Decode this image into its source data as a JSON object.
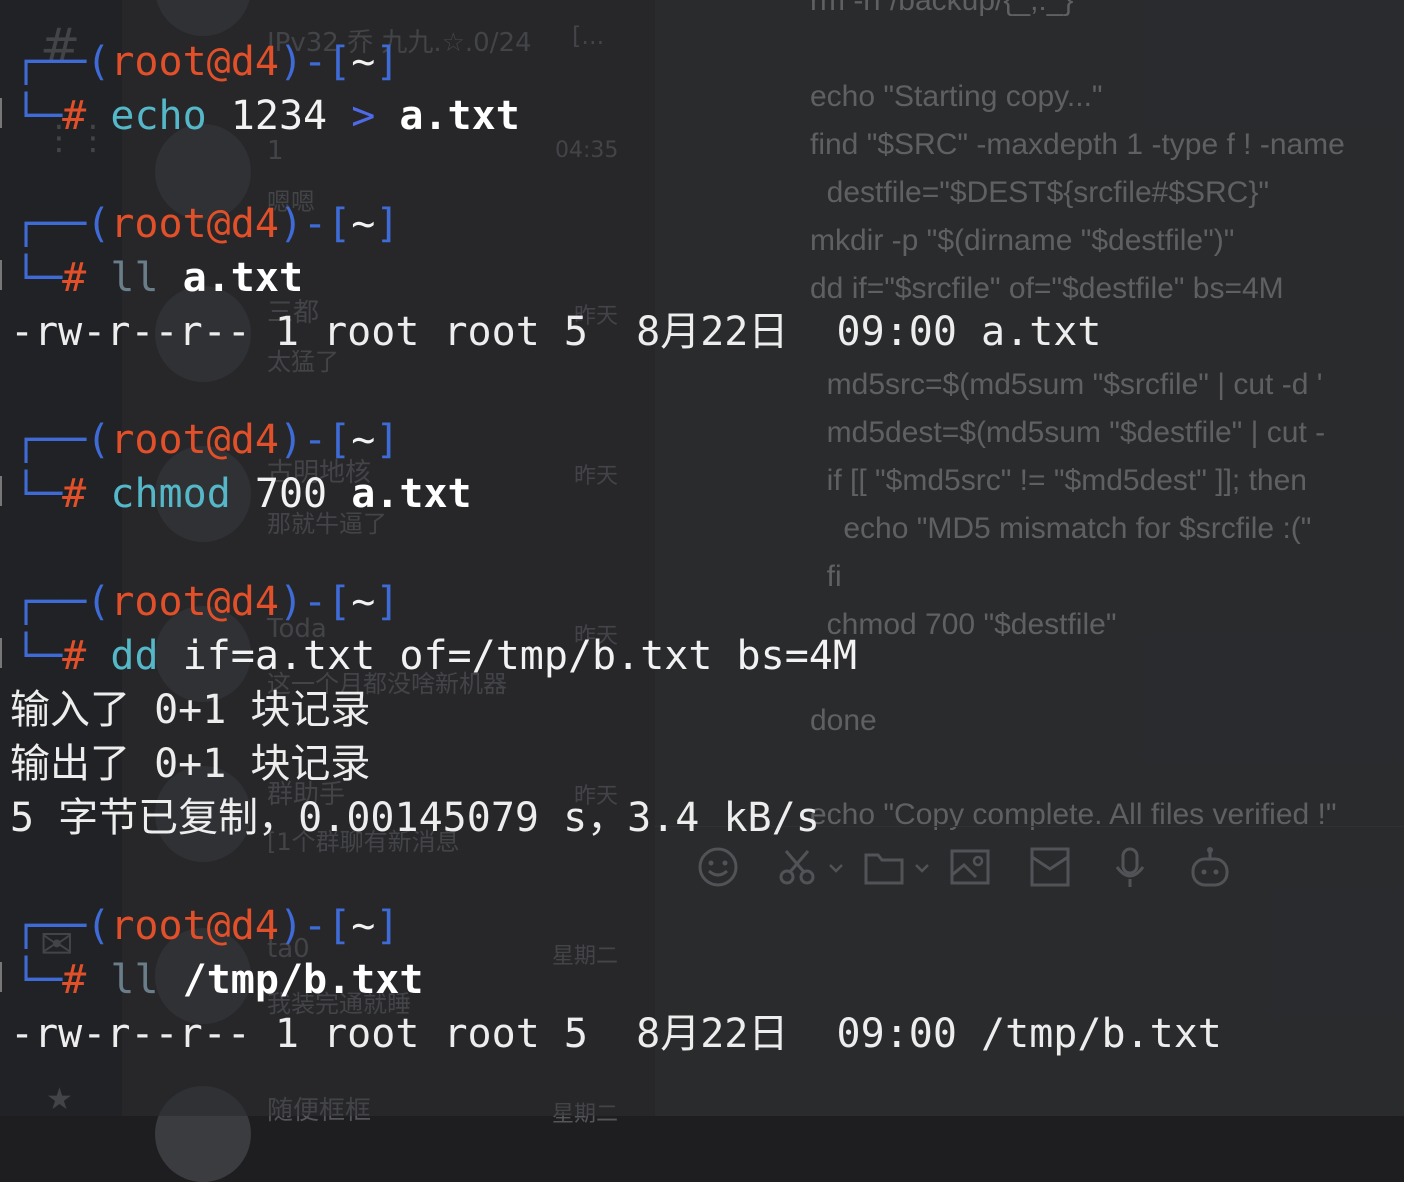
{
  "background_app": {
    "list_items": [
      {
        "name": "IPv32 乔 九九.☆.0/24",
        "preview": "[...",
        "time": ""
      },
      {
        "name": "1",
        "preview": "嗯嗯",
        "time": "04:35"
      },
      {
        "name": "三都",
        "preview": "太猛了",
        "time": "昨天"
      },
      {
        "name": "古明地核",
        "preview": "那就牛逼了",
        "time": "昨天"
      },
      {
        "name": "Toda",
        "preview": "这一个月都没啥新机器",
        "time": "昨天"
      },
      {
        "name": "群助手",
        "preview": "[1个群聊有新消息",
        "time": "昨天"
      },
      {
        "name": "ta0",
        "preview": "我装完通就睡",
        "time": "星期二"
      },
      {
        "name": "随便框框",
        "preview": "",
        "time": "星期二"
      }
    ],
    "chat_code_lines": [
      "rm -rf /backup/{_,:_}",
      "",
      "echo \"Starting copy...\"",
      "find \"$SRC\" -maxdepth 1 -type f ! -name",
      "  destfile=\"$DEST${srcfile#$SRC}\"",
      "mkdir -p \"$(dirname \"$destfile\")\"",
      "dd if=\"$srcfile\" of=\"$destfile\" bs=4M",
      "",
      "  md5src=$(md5sum \"$srcfile\" | cut -d '",
      "  md5dest=$(md5sum \"$destfile\" | cut -",
      "  if [[ \"$md5src\" != \"$md5dest\" ]]; then",
      "    echo \"MD5 mismatch for $srcfile :(\"",
      "  fi",
      "  chmod 700 \"$destfile\"",
      "",
      "done",
      "",
      "echo \"Copy complete. All files verified !\""
    ],
    "toolbar_icons": [
      "emoji-icon",
      "scissors-icon",
      "folder-icon",
      "image-icon",
      "envelope-icon",
      "microphone-icon",
      "robot-icon"
    ]
  },
  "terminal": {
    "prompt": {
      "corner_top": "┌──",
      "open": "(",
      "user": "root",
      "at": "@",
      "host": "d4",
      "close": ")",
      "dash": "-",
      "lb": "[",
      "dir": "~",
      "rb": "]",
      "corner_bottom": "└─",
      "hash": "#"
    },
    "blocks": [
      {
        "cmd": "echo",
        "args": [
          "1234",
          ">",
          "a.txt"
        ],
        "output": []
      },
      {
        "cmd": "ll",
        "args": [
          "a.txt"
        ],
        "output": [
          "-rw-r--r-- 1 root root 5  8月22日  09:00 a.txt"
        ]
      },
      {
        "cmd": "chmod",
        "args": [
          "700",
          "a.txt"
        ],
        "output": []
      },
      {
        "cmd": "dd",
        "args": [
          "if=a.txt",
          "of=/tmp/b.txt",
          "bs=4M"
        ],
        "output": [
          "输入了 0+1 块记录",
          "输出了 0+1 块记录",
          "5 字节已复制，0.00145079 s，3.4 kB/s"
        ]
      },
      {
        "cmd": "ll",
        "args": [
          "/tmp/b.txt"
        ],
        "output": [
          "-rw-r--r-- 1 root root 5  8月22日  09:00 /tmp/b.txt"
        ]
      }
    ]
  }
}
